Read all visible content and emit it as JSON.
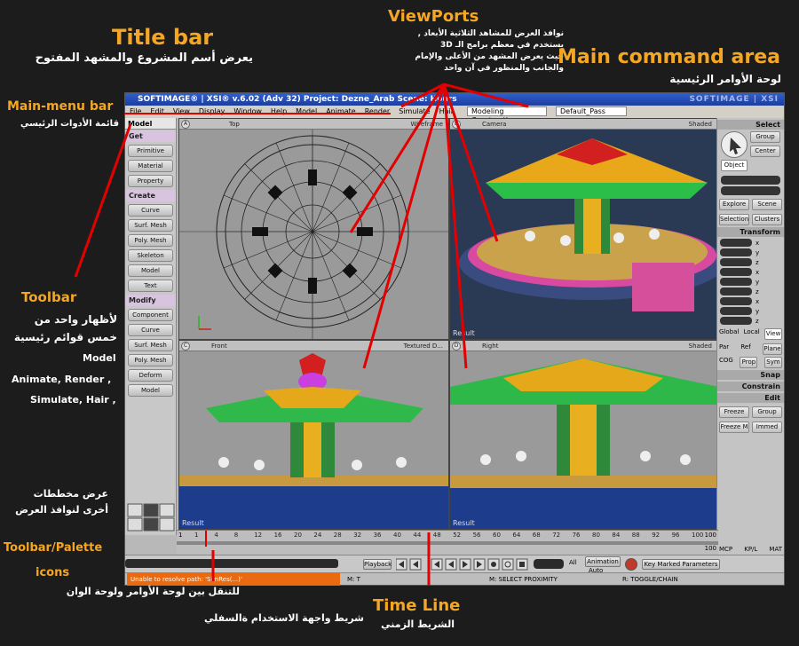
{
  "annotations": {
    "title_bar": {
      "en": "Title bar",
      "ar": "يعرض أسم المشروع والمشهد المفتوح"
    },
    "viewports": {
      "en": "ViewPorts",
      "ar": [
        "نوافذ العرض للمشاهد الثلاثية الأبعاد ,",
        "يستخدم في معظم برامج الـ 3D",
        "حيث يعرض المشهد من الأعلى والإمام",
        "والجانب والمنظور في آن واحد"
      ]
    },
    "main_command_area": {
      "en": "Main command area",
      "ar": "لوحة الأوامر الرئيسية"
    },
    "main_menu_bar": {
      "en": "Main-menu bar",
      "ar": "قائمة الأدوات الرئيسي"
    },
    "toolbar": {
      "en": "Toolbar",
      "ar": [
        "لأظهار واحد من",
        "خمس قوائم رئيسية"
      ],
      "items": [
        "Model",
        "Animate, Render  ,",
        "Simulate, Hair ,"
      ]
    },
    "layouts": {
      "ar": [
        "عرض مخططات",
        "أخرى لنوافذ العرض"
      ]
    },
    "toolbar_palette": {
      "en": [
        "Toolbar/Palette",
        "icons"
      ],
      "ar": "للتنقل بين لوحة الأوامر ولوحة الوان"
    },
    "lower_bar": {
      "ar": "شريط واجهة الاستخدام ةالسفلي"
    },
    "timeline": {
      "en": "Time Line",
      "ar": "الشريط الزمني"
    }
  },
  "app": {
    "title": "SOFTIMAGE® | XSI® v.6.02 (Adv 32) Project: Dezne_Arab    Scene: Hours",
    "logo": "SOFTIMAGE | XSI",
    "menu": [
      "File",
      "Edit",
      "View",
      "Display",
      "Window",
      "Help",
      "Model",
      "Animate",
      "Render",
      "Simulate",
      "Hair"
    ],
    "combo_1": "Modeling Construction...",
    "combo_2": "Default_Pass"
  },
  "toolbar": {
    "top": "Model",
    "sections": [
      {
        "head": "Get",
        "items": [
          "Primitive",
          "Material",
          "Property"
        ]
      },
      {
        "head": "Create",
        "items": [
          "Curve",
          "Surf. Mesh",
          "Poly. Mesh",
          "Skeleton",
          "Model",
          "Text"
        ]
      },
      {
        "head": "Modify",
        "items": [
          "Component",
          "Curve",
          "Surf. Mesh",
          "Poly. Mesh",
          "Deform",
          "Model"
        ]
      }
    ]
  },
  "viewports": {
    "a": {
      "letter": "A",
      "name": "Top",
      "mode": "Wireframe"
    },
    "b": {
      "letter": "B",
      "name": "Camera",
      "mode": "Shaded",
      "result": "Result"
    },
    "c": {
      "letter": "C",
      "name": "Front",
      "mode": "Textured D...",
      "result": "Result"
    },
    "d": {
      "letter": "D",
      "name": "Right",
      "mode": "Shaded",
      "result": "Result"
    }
  },
  "command": {
    "select": "Select",
    "group": "Group",
    "center": "Center",
    "object": "Object",
    "explore": "Explore",
    "scene": "Scene",
    "selection": "Selection",
    "clusters": "Clusters",
    "transform": "Transform",
    "axes": [
      "x",
      "y",
      "z"
    ],
    "global": "Global",
    "local": "Local",
    "view": "View",
    "par": "Par",
    "ref": "Ref",
    "plane": "Plane",
    "cog": "COG",
    "prop": "Prop",
    "sym": "Sym",
    "snap": "Snap",
    "constrain": "Constrain",
    "edit": "Edit",
    "freeze": "Freeze",
    "group2": "Group",
    "freeze_m": "Freeze M",
    "immed": "Immed",
    "tabs": [
      "MCP",
      "KP/L",
      "MAT"
    ]
  },
  "timeline": {
    "ticks": [
      "1",
      "4",
      "8",
      "12",
      "16",
      "20",
      "24",
      "28",
      "32",
      "36",
      "40",
      "44",
      "48",
      "52",
      "56",
      "60",
      "64",
      "68",
      "72",
      "76",
      "80",
      "84",
      "88",
      "92",
      "96",
      "100"
    ],
    "start": "1",
    "end": "100",
    "end2": "100"
  },
  "playbar": {
    "playback": "Playback",
    "all": "All",
    "animation": "Animation",
    "auto": "Auto",
    "key_marked": "Key Marked Parameters"
  },
  "status": {
    "warning": "Unable to resolve path: 'SimRes(...)'",
    "seg1": "M: T",
    "seg2": "M: SELECT PROXIMITY",
    "seg3": "R: TOGGLE/CHAIN"
  }
}
